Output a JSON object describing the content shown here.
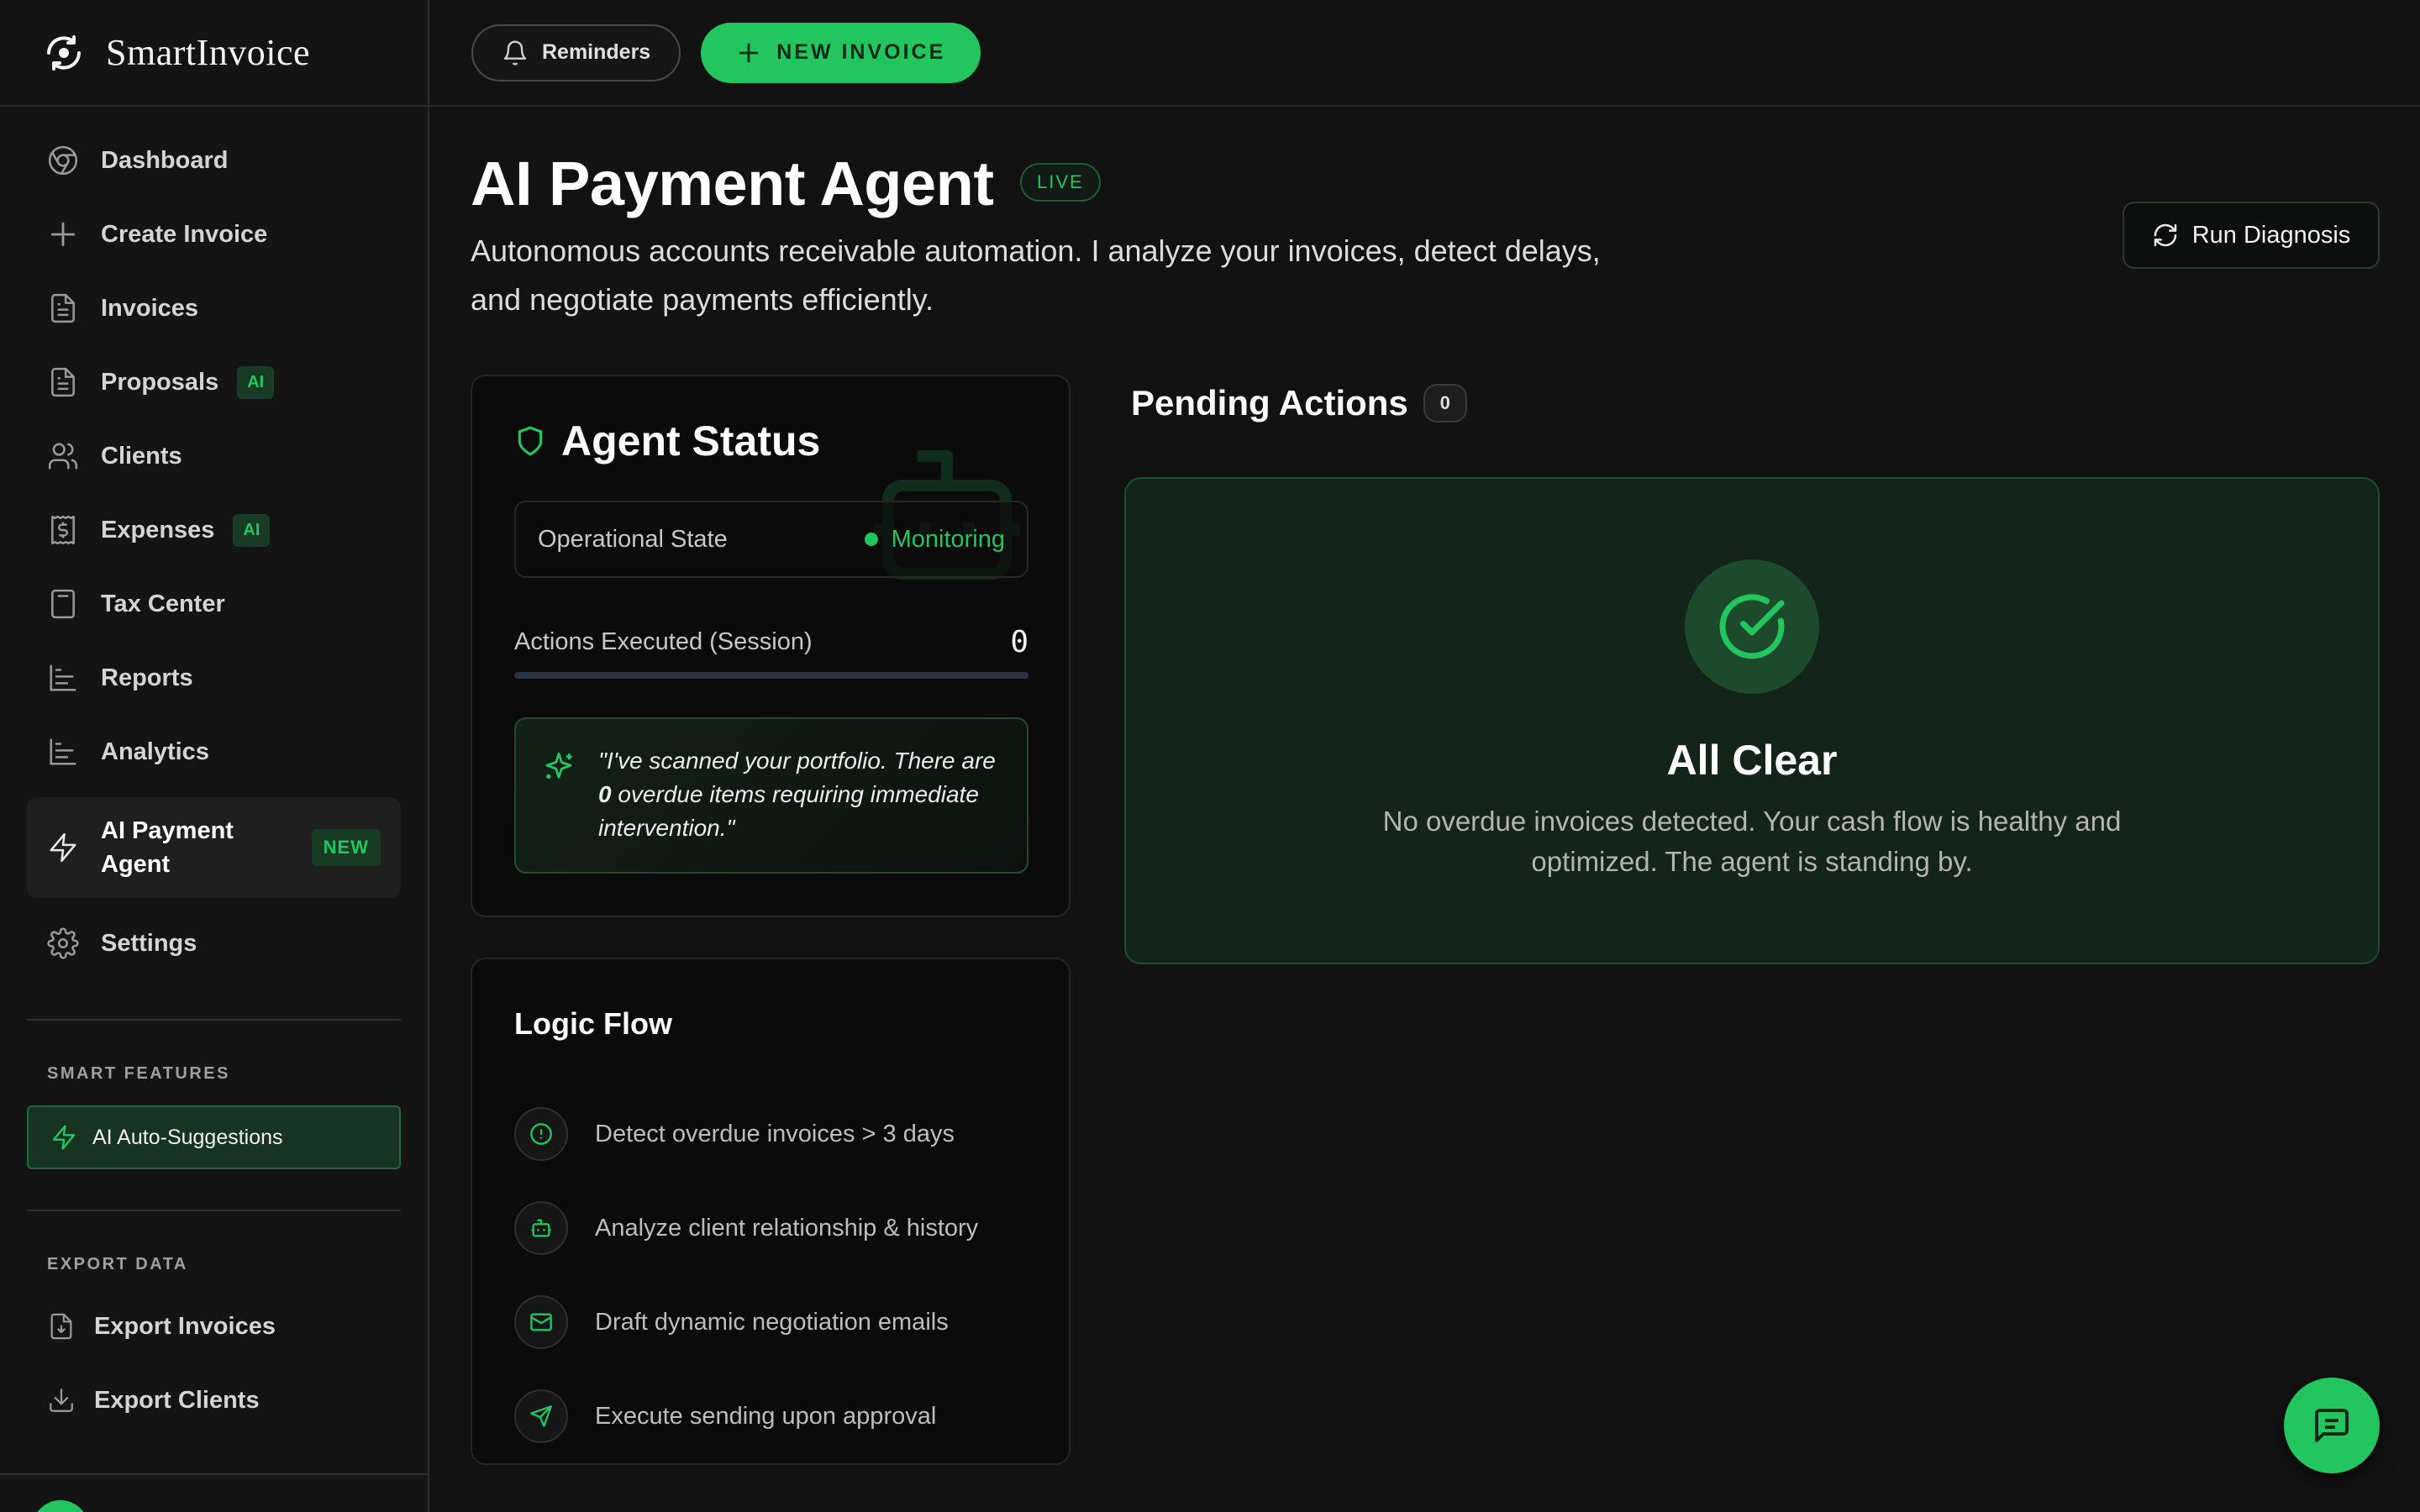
{
  "brand": {
    "name": "SmartInvoice"
  },
  "topbar": {
    "reminders_label": "Reminders",
    "new_invoice_label": "NEW INVOICE"
  },
  "sidebar": {
    "items": [
      {
        "label": "Dashboard",
        "icon": "chrome-icon"
      },
      {
        "label": "Create Invoice",
        "icon": "plus-icon"
      },
      {
        "label": "Invoices",
        "icon": "file-text-icon"
      },
      {
        "label": "Proposals",
        "icon": "file-text-icon",
        "badge": "AI"
      },
      {
        "label": "Clients",
        "icon": "users-icon"
      },
      {
        "label": "Expenses",
        "icon": "receipt-icon",
        "badge": "AI"
      },
      {
        "label": "Tax Center",
        "icon": "calculator-icon"
      },
      {
        "label": "Reports",
        "icon": "bar-chart-icon"
      },
      {
        "label": "Analytics",
        "icon": "bar-chart-icon"
      },
      {
        "label": "AI Payment Agent",
        "icon": "zap-icon",
        "badge": "NEW",
        "active": true
      },
      {
        "label": "Settings",
        "icon": "gear-icon"
      }
    ],
    "smart_features_title": "SMART FEATURES",
    "smart_features_button": "AI Auto-Suggestions",
    "export_title": "EXPORT DATA",
    "export_items": [
      {
        "label": "Export Invoices",
        "icon": "file-download-icon"
      },
      {
        "label": "Export Clients",
        "icon": "download-icon"
      }
    ]
  },
  "page": {
    "title": "AI Payment Agent",
    "live_badge": "LIVE",
    "subtitle": "Autonomous accounts receivable automation. I analyze your invoices, detect delays, and negotiate payments efficiently.",
    "run_diagnosis_label": "Run Diagnosis"
  },
  "agent_status": {
    "title": "Agent Status",
    "operational_state_label": "Operational State",
    "operational_state_value": "Monitoring",
    "actions_executed_label": "Actions Executed (Session)",
    "actions_executed_value": "0",
    "actions_progress": 0,
    "quote_before": "\"I've scanned your portfolio. There are ",
    "quote_count": "0",
    "quote_after": " overdue items requiring immediate intervention.\""
  },
  "logic_flow": {
    "title": "Logic Flow",
    "steps": [
      {
        "label": "Detect overdue invoices > 3 days",
        "icon": "alert-circle-icon"
      },
      {
        "label": "Analyze client relationship & history",
        "icon": "bot-icon"
      },
      {
        "label": "Draft dynamic negotiation emails",
        "icon": "mail-icon"
      },
      {
        "label": "Execute sending upon approval",
        "icon": "send-icon"
      }
    ]
  },
  "pending_actions": {
    "title": "Pending Actions",
    "count": "0",
    "empty_title": "All Clear",
    "empty_text": "No overdue invoices detected. Your cash flow is healthy and optimized. The agent is standing by."
  },
  "colors": {
    "accent": "#22c55e",
    "background": "#121212",
    "card": "#0b0b0b"
  }
}
